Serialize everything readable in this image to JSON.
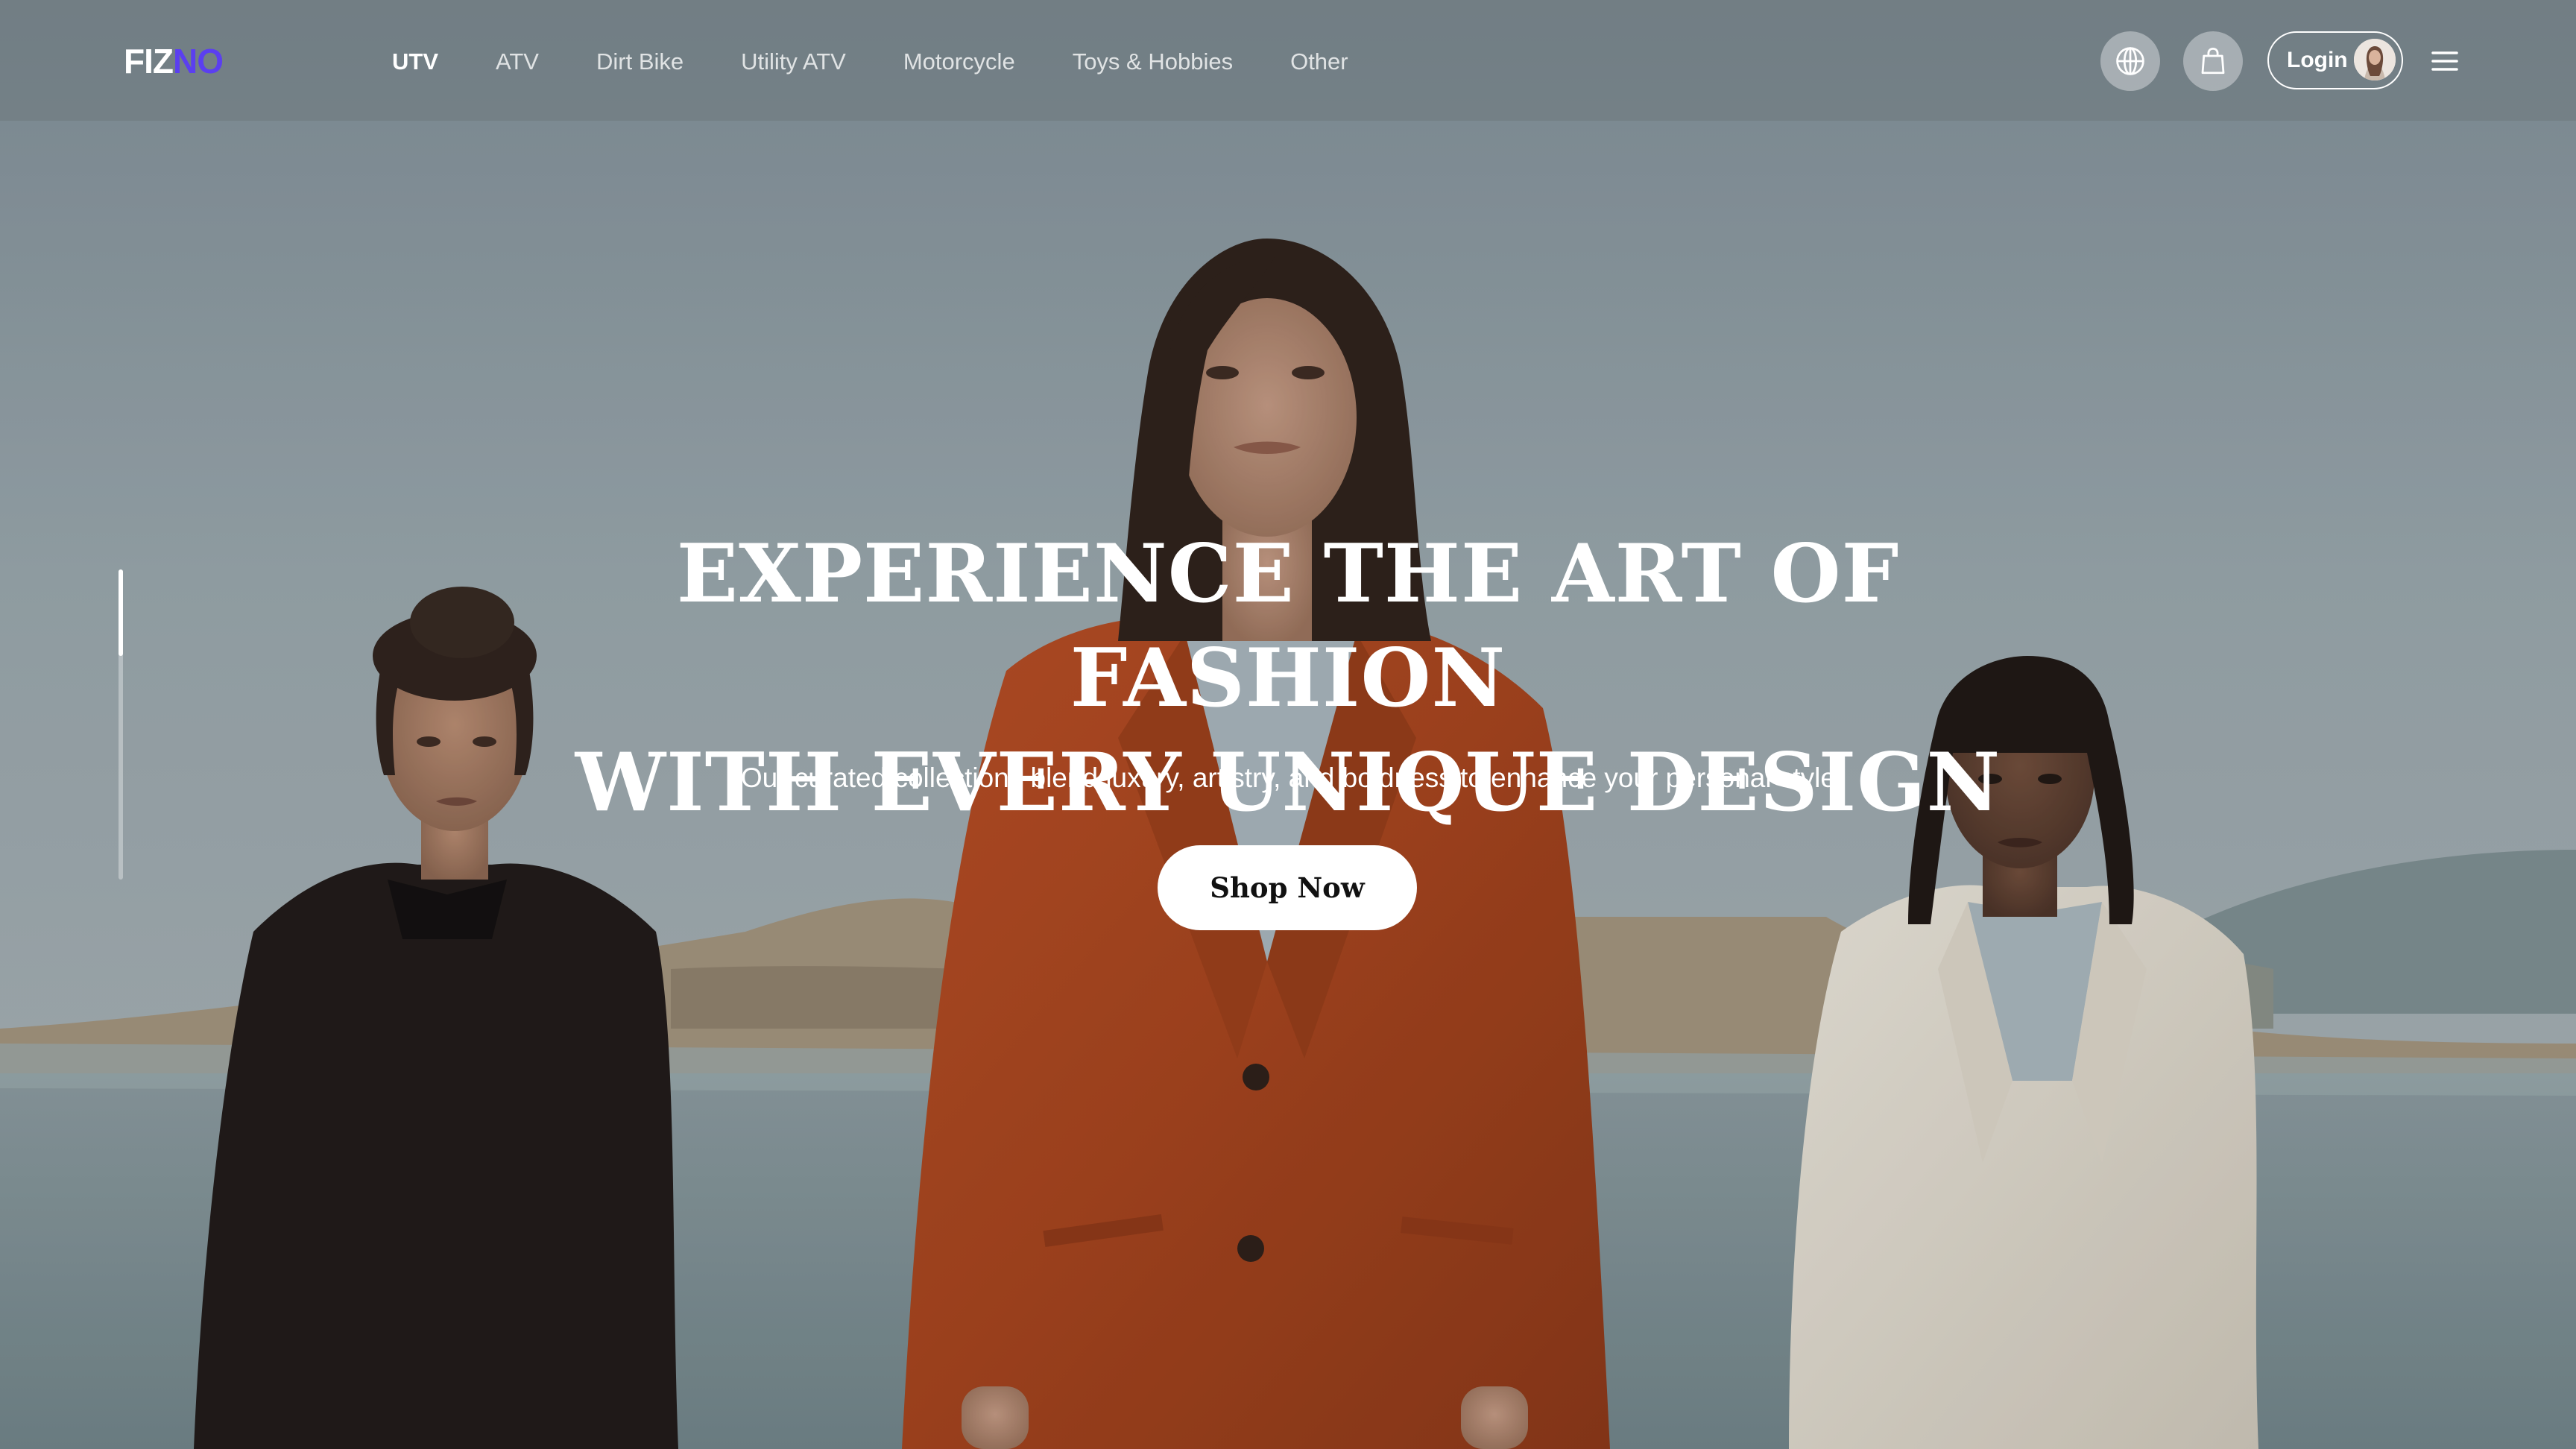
{
  "brand": {
    "logo_part1": "FIZ",
    "logo_part2": "NO"
  },
  "nav": {
    "items": [
      {
        "label": "UTV",
        "active": true
      },
      {
        "label": "ATV",
        "active": false
      },
      {
        "label": "Dirt Bike",
        "active": false
      },
      {
        "label": "Utility ATV",
        "active": false
      },
      {
        "label": "Motorcycle",
        "active": false
      },
      {
        "label": "Toys & Hobbies",
        "active": false
      },
      {
        "label": "Other",
        "active": false
      }
    ]
  },
  "header_actions": {
    "language_icon": "globe-icon",
    "cart_icon": "shopping-bag-icon",
    "login_label": "Login",
    "menu_icon": "hamburger-menu-icon"
  },
  "hero": {
    "headline_line1": "EXPERIENCE THE ART OF FASHION",
    "headline_line2": "WITH EVERY UNIQUE DESIGN",
    "subtitle": "\"Our curated collections blend luxury, artistry, and boldness to enhance your personal style”",
    "cta_label": "Shop Now",
    "slide_progress": 0.28
  },
  "colors": {
    "brand_accent": "#5b3ff0",
    "text_primary": "#ffffff",
    "cta_background": "#ffffff",
    "cta_text": "#111111"
  }
}
